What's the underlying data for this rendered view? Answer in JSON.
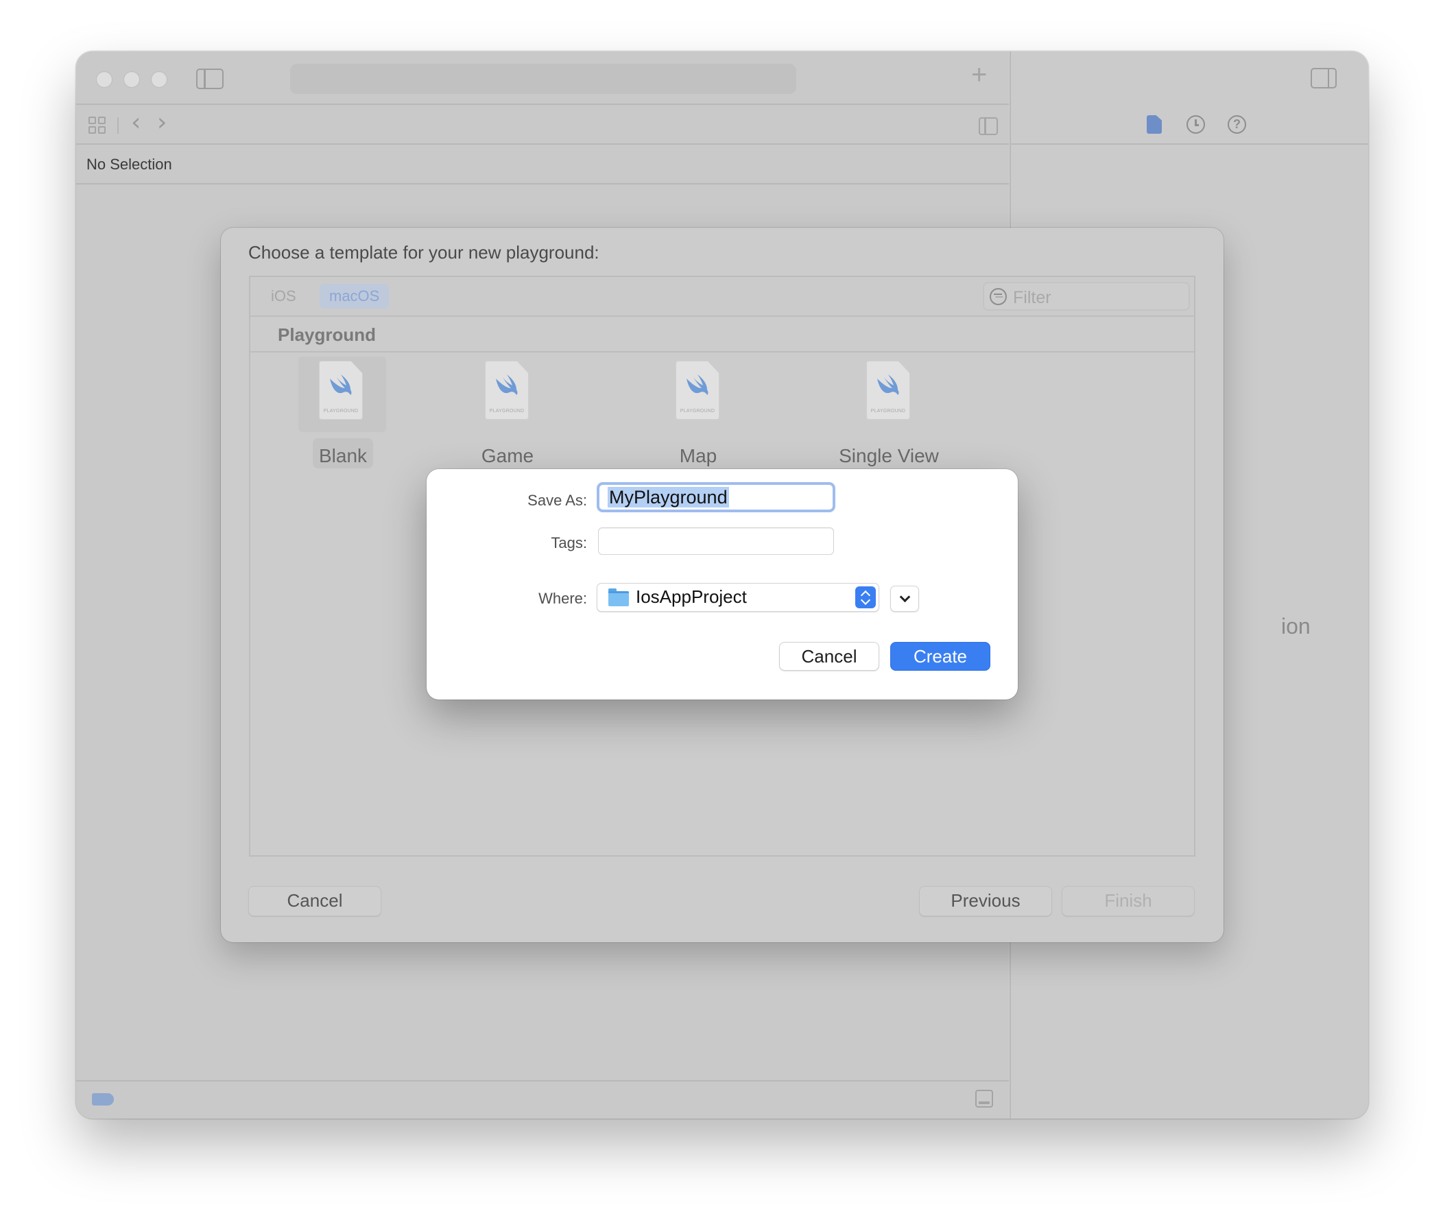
{
  "editor": {
    "path_bar_text": "No Selection"
  },
  "inspector": {
    "partial_text": "ion"
  },
  "template_sheet": {
    "title": "Choose a template for your new playground:",
    "platform_tabs": [
      {
        "label": "iOS",
        "selected": false
      },
      {
        "label": "macOS",
        "selected": true
      }
    ],
    "filter_placeholder": "Filter",
    "section": "Playground",
    "doc_badge": "PLAYGROUND",
    "templates": [
      {
        "name": "Blank",
        "selected": true
      },
      {
        "name": "Game",
        "selected": false
      },
      {
        "name": "Map",
        "selected": false
      },
      {
        "name": "Single View",
        "selected": false
      }
    ],
    "cancel_label": "Cancel",
    "previous_label": "Previous",
    "finish_label": "Finish"
  },
  "save_dialog": {
    "save_as_label": "Save As:",
    "save_as_value": "MyPlayground",
    "tags_label": "Tags:",
    "tags_value": "",
    "where_label": "Where:",
    "where_value": "IosAppProject",
    "cancel_label": "Cancel",
    "create_label": "Create"
  },
  "colors": {
    "accent": "#3a7ff2",
    "selection_highlight": "#b4cff4",
    "swift_icon": "#6f9bd6"
  }
}
